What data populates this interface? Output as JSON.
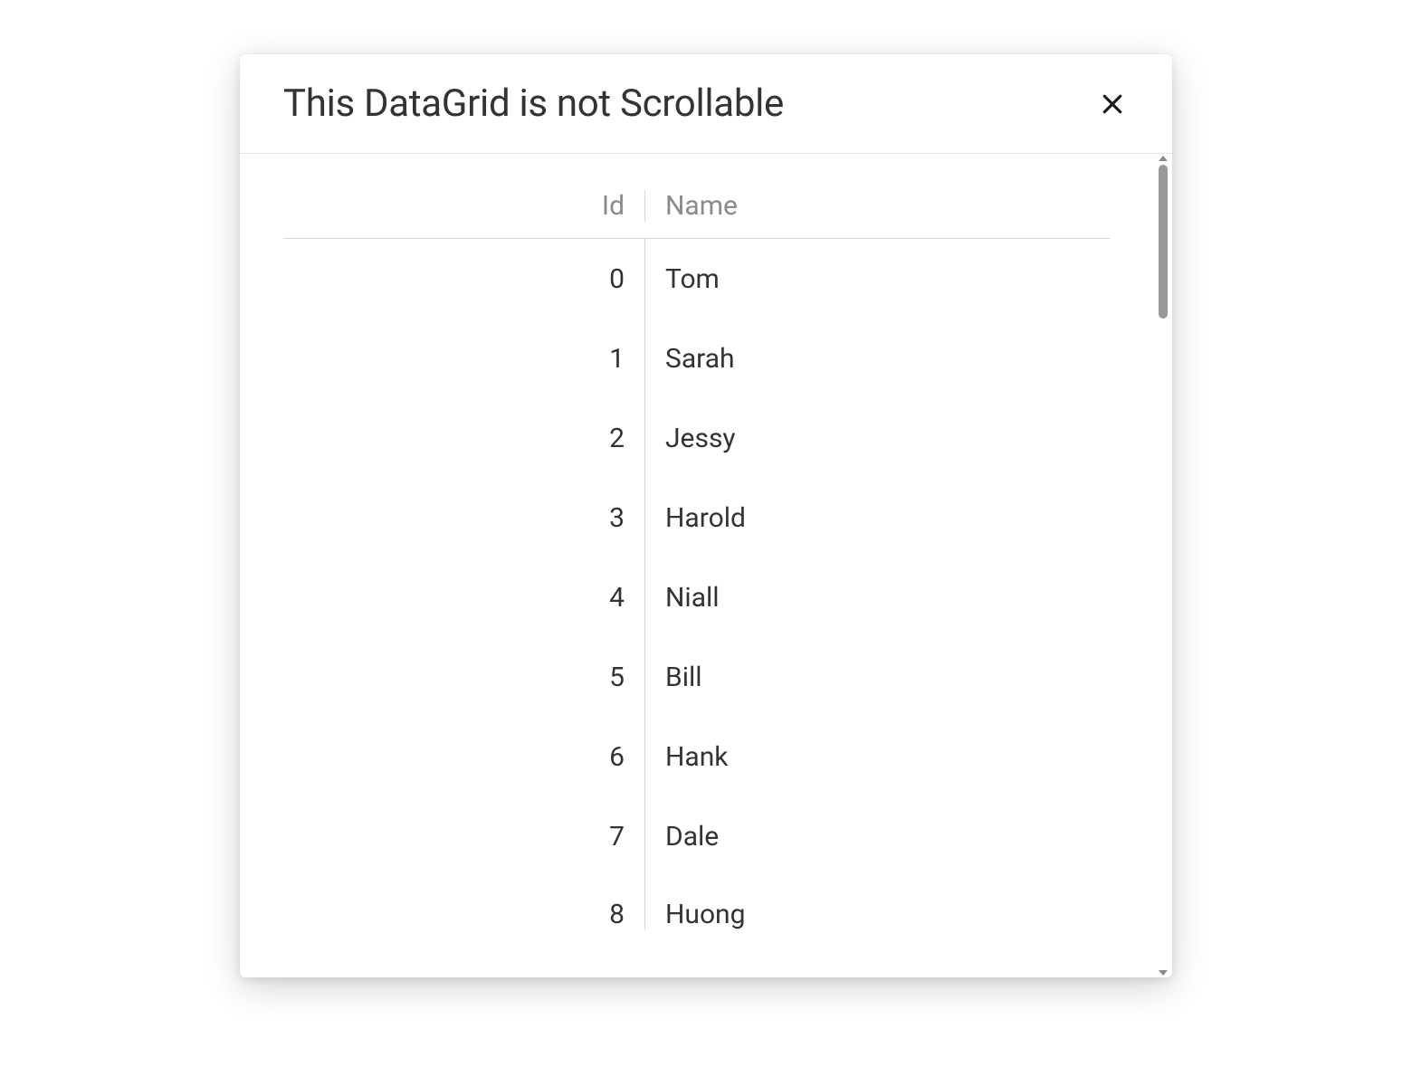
{
  "dialog": {
    "title": "This DataGrid is not Scrollable",
    "columns": {
      "id": "Id",
      "name": "Name"
    },
    "rows": [
      {
        "id": "0",
        "name": "Tom"
      },
      {
        "id": "1",
        "name": "Sarah"
      },
      {
        "id": "2",
        "name": "Jessy"
      },
      {
        "id": "3",
        "name": "Harold"
      },
      {
        "id": "4",
        "name": "Niall"
      },
      {
        "id": "5",
        "name": "Bill"
      },
      {
        "id": "6",
        "name": "Hank"
      },
      {
        "id": "7",
        "name": "Dale"
      },
      {
        "id": "8",
        "name": "Huong"
      }
    ]
  }
}
